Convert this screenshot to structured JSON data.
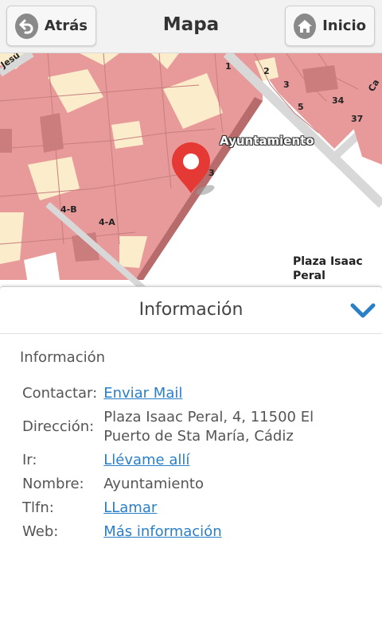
{
  "header": {
    "back_label": "Atrás",
    "title": "Mapa",
    "home_label": "Inicio"
  },
  "map": {
    "poi_label": "Ayuntamiento",
    "place_label": "Plaza Isaac Peral",
    "street_numbers": [
      "1",
      "2",
      "3",
      "5",
      "34",
      "37",
      "4-B",
      "4-A",
      "3"
    ],
    "street_fragments": [
      "Jesú",
      "Ca"
    ]
  },
  "panel": {
    "header_title": "Información",
    "section_title": "Información",
    "rows": [
      {
        "key": "Contactar:",
        "value": "Enviar Mail",
        "link": true
      },
      {
        "key": "Dirección:",
        "value": "Plaza Isaac Peral, 4, 11500 El Puerto de Sta María, Cádiz",
        "link": false
      },
      {
        "key": "Ir:",
        "value": "Llévame allí",
        "link": true
      },
      {
        "key": "Nombre:",
        "value": "Ayuntamiento",
        "link": false
      },
      {
        "key": "Tlfn:",
        "value": "LLamar",
        "link": true
      },
      {
        "key": "Web:",
        "value": "Más información",
        "link": true
      }
    ]
  },
  "colors": {
    "building": "#e89a9a",
    "building_dark": "#b86b6b",
    "plaza": "#fbeccb",
    "marker": "#e53935",
    "link": "#2a7fc9",
    "chevron": "#2a7fc9"
  }
}
